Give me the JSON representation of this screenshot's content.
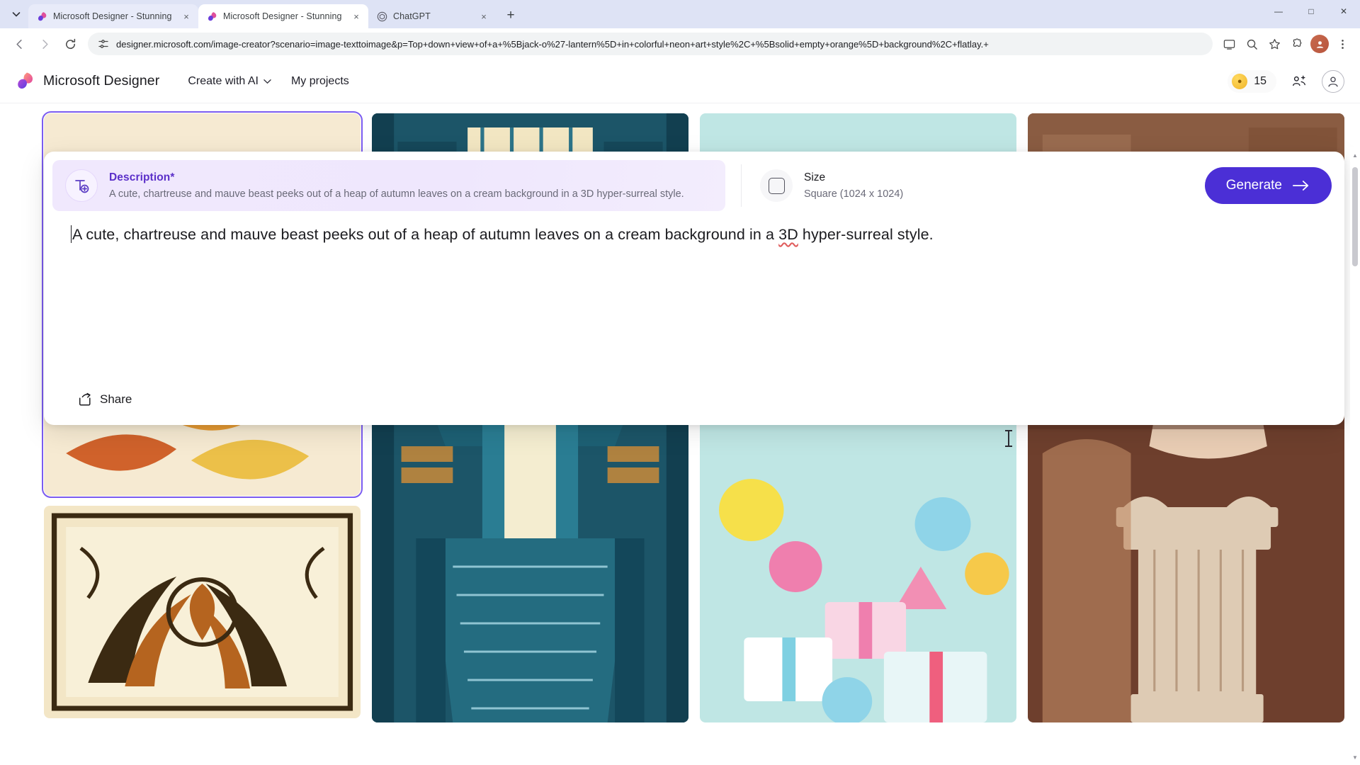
{
  "browser": {
    "tabs": [
      {
        "title": "Microsoft Designer - Stunning d",
        "favicon": "designer-icon",
        "active": false
      },
      {
        "title": "Microsoft Designer - Stunning d",
        "favicon": "designer-icon",
        "active": true
      },
      {
        "title": "ChatGPT",
        "favicon": "chatgpt-icon",
        "active": false
      }
    ],
    "tab_close_label": "×",
    "new_tab_label": "+",
    "tab_search_icon": "chevron-down-icon",
    "window_controls": {
      "minimize": "—",
      "maximize": "□",
      "close": "✕"
    },
    "nav": {
      "back": "←",
      "forward": "→",
      "reload": "⟳"
    },
    "omnibox": {
      "site_settings_icon": "tune-icon",
      "url": "designer.microsoft.com/image-creator?scenario=image-texttoimage&p=Top+down+view+of+a+%5Bjack-o%27-lantern%5D+in+colorful+neon+art+style%2C+%5Bsolid+empty+orange%5D+background%2C+flatlay.+",
      "install_icon": "install-app-icon",
      "zoom_icon": "zoom-icon",
      "bookmark_icon": "star-icon",
      "extensions_icon": "extensions-icon",
      "profile_icon": "profile-avatar",
      "menu_icon": "kebab-menu-icon"
    }
  },
  "app": {
    "brand": "Microsoft Designer",
    "nav_items": [
      {
        "label": "Create with AI",
        "has_chevron": true
      },
      {
        "label": "My projects",
        "has_chevron": false
      }
    ],
    "credits": {
      "value": "15",
      "icon": "coin-icon"
    },
    "share_header_icon": "share-people-icon",
    "account_icon": "account-circle-icon"
  },
  "prompt_panel": {
    "description": {
      "icon": "add-text-icon",
      "label": "Description*",
      "text": "A cute, chartreuse and mauve beast peeks out of a heap of autumn leaves on a cream background in a 3D hyper-surreal style."
    },
    "size": {
      "icon": "square-shape-icon",
      "label": "Size",
      "value": "Square (1024 x 1024)"
    },
    "generate": {
      "label": "Generate",
      "arrow": "→"
    },
    "editor": {
      "text_before": "A cute, chartreuse and mauve beast peeks out of a heap of autumn leaves on a cream background in a ",
      "misspelled_word": "3D",
      "text_after": " hyper-surreal style."
    },
    "share": {
      "label": "Share",
      "icon": "share-icon"
    }
  },
  "gallery": {
    "items": [
      {
        "name": "autumn-leaves-beast",
        "selected": true,
        "alt": "3D cute green beast peeking out of colorful autumn leaves"
      },
      {
        "name": "grand-library",
        "selected": false,
        "alt": "Illustrated grand library interior with staircases and bookshelves"
      },
      {
        "name": "party-banners",
        "selected": false,
        "alt": "Pastel party scene with bunting, balloons and gift boxes"
      },
      {
        "name": "classical-statue",
        "selected": false,
        "alt": "Classical marble statue on a column in a warm interior"
      },
      {
        "name": "pumpkin-woodcut",
        "selected": false,
        "alt": "Cream and orange woodcut style pumpkin and foliage pattern"
      }
    ]
  },
  "scrollbar": {
    "up_arrow": "▲",
    "down_arrow": "▼"
  },
  "colors": {
    "accent": "#4b2fd6",
    "description_label": "#5b2fc9",
    "description_bg": "#f0e8fd",
    "tabstrip_bg": "#dee3f5",
    "selected_outline": "#7b5cf0"
  }
}
